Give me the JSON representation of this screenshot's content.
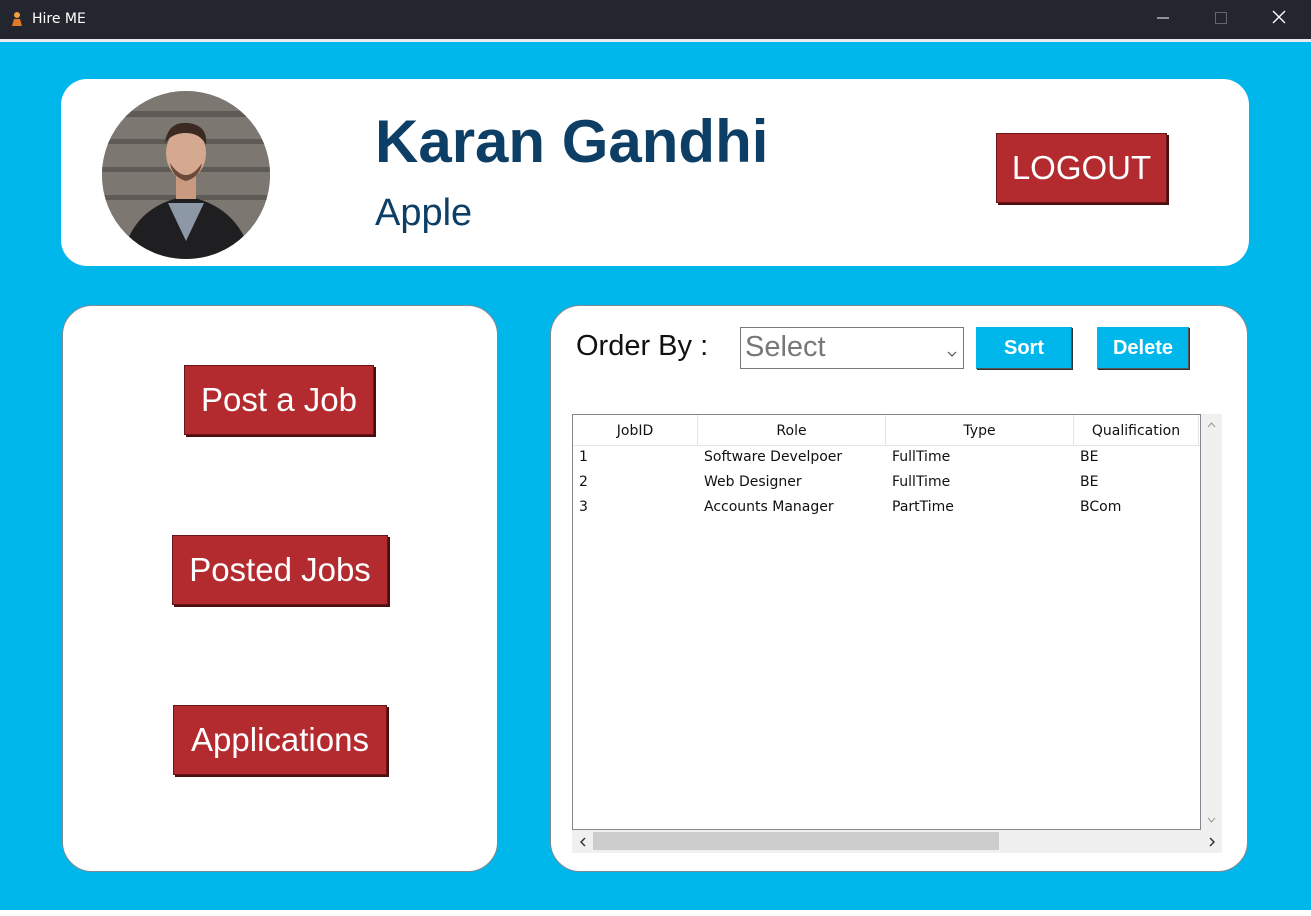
{
  "window": {
    "title": "Hire ME",
    "controls": {
      "minimize": "minimize-icon",
      "maximize": "maximize-icon",
      "close": "close-icon"
    }
  },
  "header": {
    "name": "Karan Gandhi",
    "company": "Apple",
    "logout_label": "LOGOUT",
    "avatar": "profile-photo"
  },
  "sidebar": {
    "items": [
      {
        "label": "Post a Job"
      },
      {
        "label": "Posted Jobs"
      },
      {
        "label": "Applications"
      }
    ]
  },
  "jobs": {
    "order_label": "Order By :",
    "select_value": "Select",
    "sort_label": "Sort",
    "delete_label": "Delete",
    "columns": [
      "JobID",
      "Role",
      "Type",
      "Qualification"
    ],
    "rows": [
      [
        "1",
        "Software Develpoer",
        "FullTime",
        "BE"
      ],
      [
        "2",
        "Web Designer",
        "FullTime",
        "BE"
      ],
      [
        "3",
        "Accounts Manager",
        "PartTime",
        "BCom"
      ]
    ]
  },
  "colors": {
    "background": "#00b7ec",
    "primary_button": "#b42b2f",
    "accent_button": "#00b7ec",
    "heading": "#0d3f66"
  }
}
